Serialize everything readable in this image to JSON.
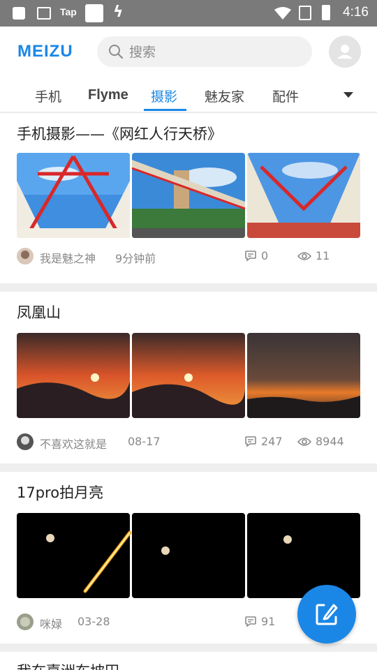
{
  "status_bar": {
    "carrier_label": "Tap",
    "time": "4:16"
  },
  "header": {
    "logo": "MEIZU",
    "search_placeholder": "搜索"
  },
  "tabs": [
    {
      "label": "手机"
    },
    {
      "label": "Flyme"
    },
    {
      "label": "摄影",
      "active": true
    },
    {
      "label": "魅友家"
    },
    {
      "label": "配件"
    }
  ],
  "posts": [
    {
      "title": "手机摄影——《网红人行天桥》",
      "author": "我是魅之神",
      "time": "9分钟前",
      "comments": "0",
      "views": "11",
      "images": [
        "bridge-sky",
        "bridge-side",
        "bridge-sky-2"
      ]
    },
    {
      "title": "凤凰山",
      "author": "不喜欢这就是",
      "time": "08-17",
      "comments": "247",
      "views": "8944",
      "images": [
        "sunset-1",
        "sunset-2",
        "sunset-3"
      ]
    },
    {
      "title": "17pro拍月亮",
      "author": "咪娽",
      "time": "03-28",
      "comments": "91",
      "views": "",
      "images": [
        "moon-1",
        "moon-streak",
        "moon-2"
      ]
    },
    {
      "title": "我在嘉洲布坡田",
      "partial": true
    }
  ],
  "colors": {
    "accent": "#1a87e6",
    "status_bar": "#7a7a7a",
    "divider": "#eeeeee"
  },
  "icons": [
    "search-icon",
    "user-icon",
    "comment-icon",
    "eye-icon",
    "edit-icon",
    "dropdown-arrow-icon",
    "wifi-icon",
    "battery-icon"
  ]
}
